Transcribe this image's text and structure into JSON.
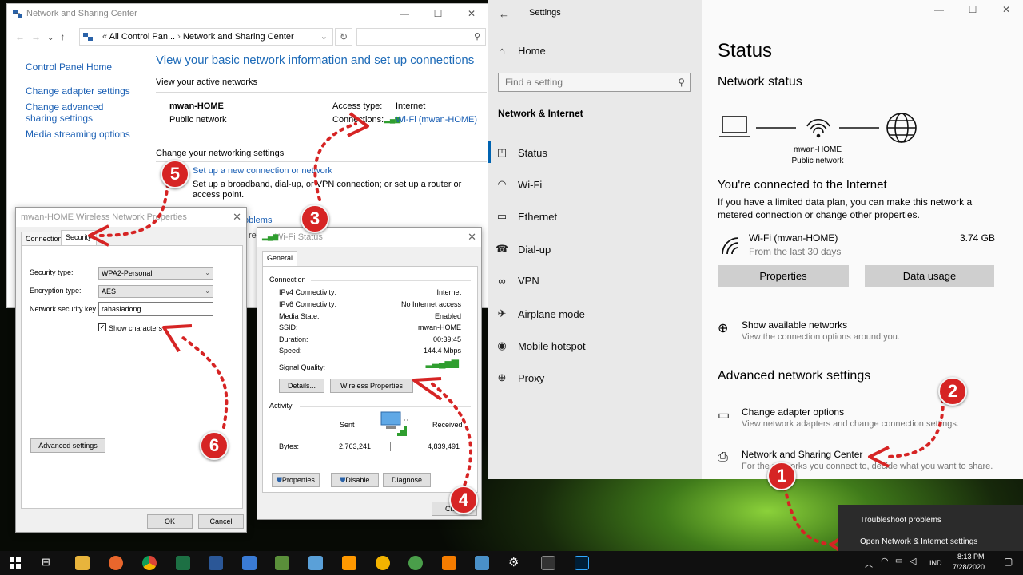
{
  "nsc": {
    "title": "Network and Sharing Center",
    "address_prefix": "All Control Pan...",
    "address_current": "Network and Sharing Center",
    "sidebar": [
      "Control Panel Home",
      "Change adapter settings",
      "Change advanced sharing settings",
      "Media streaming options"
    ],
    "heading": "View your basic network information and set up connections",
    "active_label": "View your active networks",
    "network_name": "mwan-HOME",
    "network_type": "Public network",
    "access_type_label": "Access type:",
    "access_type_value": "Internet",
    "connections_label": "Connections:",
    "connection_link": "Wi-Fi (mwan-HOME)",
    "change_label": "Change your networking settings",
    "setup_link": "Set up a new connection or network",
    "setup_desc": "Set up a broadband, dial-up, or VPN connection; or set up a router or access point.",
    "troubleshoot_partial": "oblems",
    "partial_rep": "rep"
  },
  "settings": {
    "title": "Settings",
    "home": "Home",
    "search_placeholder": "Find a setting",
    "section": "Network & Internet",
    "nav": [
      {
        "label": "Status",
        "icon": "home-status-icon"
      },
      {
        "label": "Wi-Fi",
        "icon": "wifi-icon"
      },
      {
        "label": "Ethernet",
        "icon": "ethernet-icon"
      },
      {
        "label": "Dial-up",
        "icon": "dialup-icon"
      },
      {
        "label": "VPN",
        "icon": "vpn-icon"
      },
      {
        "label": "Airplane mode",
        "icon": "airplane-icon"
      },
      {
        "label": "Mobile hotspot",
        "icon": "hotspot-icon"
      },
      {
        "label": "Proxy",
        "icon": "globe-icon"
      }
    ],
    "page_title": "Status",
    "network_status": "Network status",
    "diagram_name": "mwan-HOME",
    "diagram_type": "Public network",
    "connected": "You're connected to the Internet",
    "limited_text": "If you have a limited data plan, you can make this network a metered connection or change other properties.",
    "wifi_name": "Wi-Fi (mwan-HOME)",
    "wifi_sub": "From the last 30 days",
    "wifi_usage": "3.74 GB",
    "properties_btn": "Properties",
    "data_usage_btn": "Data usage",
    "show_networks": "Show available networks",
    "show_networks_sub": "View the connection options around you.",
    "advanced_heading": "Advanced network settings",
    "change_adapter": "Change adapter options",
    "change_adapter_sub": "View network adapters and change connection settings.",
    "nsc_link": "Network and Sharing Center",
    "nsc_sub": "For the networks you connect to, decide what you want to share."
  },
  "wprops": {
    "title": "mwan-HOME Wireless Network Properties",
    "tab_connection": "Connection",
    "tab_security": "Security",
    "security_type_label": "Security type:",
    "security_type_value": "WPA2-Personal",
    "encryption_label": "Encryption type:",
    "encryption_value": "AES",
    "key_label": "Network security key",
    "key_value": "rahasiadong",
    "show_chars": "Show characters",
    "advanced_btn": "Advanced settings",
    "ok_btn": "OK",
    "cancel_btn": "Cancel"
  },
  "wstatus": {
    "title": "Wi-Fi Status",
    "tab_general": "General",
    "connection_label": "Connection",
    "rows": [
      {
        "label": "IPv4 Connectivity:",
        "value": "Internet"
      },
      {
        "label": "IPv6 Connectivity:",
        "value": "No Internet access"
      },
      {
        "label": "Media State:",
        "value": "Enabled"
      },
      {
        "label": "SSID:",
        "value": "mwan-HOME"
      },
      {
        "label": "Duration:",
        "value": "00:39:45"
      },
      {
        "label": "Speed:",
        "value": "144.4 Mbps"
      }
    ],
    "signal_label": "Signal Quality:",
    "details_btn": "Details...",
    "wireless_props_btn": "Wireless Properties",
    "activity_label": "Activity",
    "sent_label": "Sent",
    "received_label": "Received",
    "bytes_label": "Bytes:",
    "bytes_sent": "2,763,241",
    "bytes_received": "4,839,491",
    "properties_btn": "Properties",
    "disable_btn": "Disable",
    "diagnose_btn": "Diagnose",
    "close_btn": "Close"
  },
  "popup": {
    "troubleshoot": "Troubleshoot problems",
    "open_settings": "Open Network & Internet settings"
  },
  "tray": {
    "lang": "IND",
    "time": "8:13 PM",
    "date": "7/28/2020"
  },
  "markers": [
    "1",
    "2",
    "3",
    "4",
    "5",
    "6"
  ],
  "colors": {
    "annotation": "#d62424",
    "link": "#1a5fb4",
    "heading": "#1e6bb8"
  }
}
